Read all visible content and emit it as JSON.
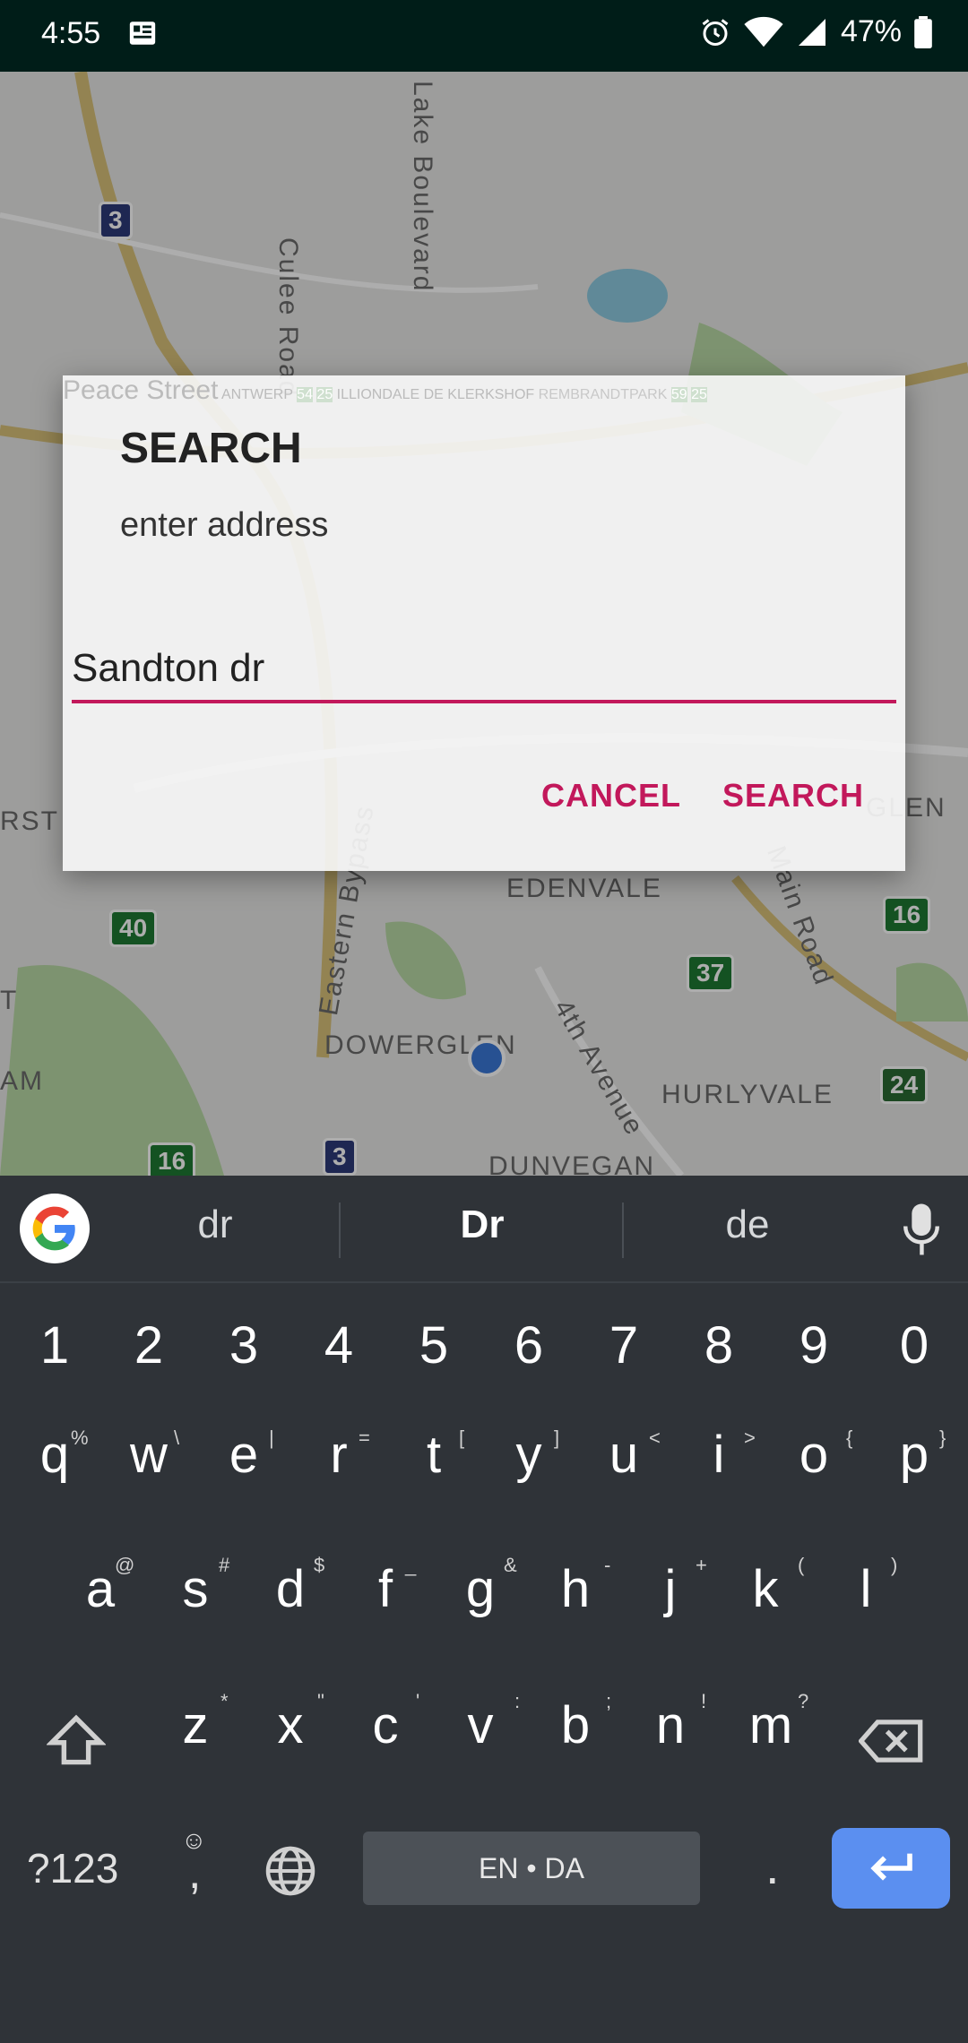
{
  "status_bar": {
    "time": "4:55",
    "battery": "47%"
  },
  "map": {
    "labels": [
      "Culee Road",
      "Lake Boulevard",
      "Peace Street",
      "ANTWERP",
      "ILLIONDALE",
      "DE KLERKSHOF",
      "REMBRANDTPARK",
      "EDENVALE",
      "Main Road",
      "Eastern Bypass",
      "DOWERGLEN",
      "4th Avenue",
      "HURLYVALE",
      "DUNVEGAN",
      "RST",
      "AM",
      "T",
      "GLEN"
    ],
    "route_shields": [
      "3",
      "54",
      "25",
      "59",
      "25",
      "40",
      "37",
      "16",
      "24",
      "16",
      "3"
    ]
  },
  "dialog": {
    "title": "SEARCH",
    "message": "enter address",
    "input_value": "Sandton dr",
    "cancel_label": "CANCEL",
    "search_label": "SEARCH"
  },
  "keyboard": {
    "suggestions": [
      "dr",
      "Dr",
      "de"
    ],
    "number_row": [
      "1",
      "2",
      "3",
      "4",
      "5",
      "6",
      "7",
      "8",
      "9",
      "0"
    ],
    "row1": [
      {
        "key": "q",
        "hint": "%"
      },
      {
        "key": "w",
        "hint": "\\"
      },
      {
        "key": "e",
        "hint": "|"
      },
      {
        "key": "r",
        "hint": "="
      },
      {
        "key": "t",
        "hint": "["
      },
      {
        "key": "y",
        "hint": "]"
      },
      {
        "key": "u",
        "hint": "<"
      },
      {
        "key": "i",
        "hint": ">"
      },
      {
        "key": "o",
        "hint": "{"
      },
      {
        "key": "p",
        "hint": "}"
      }
    ],
    "row2": [
      {
        "key": "a",
        "hint": "@"
      },
      {
        "key": "s",
        "hint": "#"
      },
      {
        "key": "d",
        "hint": "$"
      },
      {
        "key": "f",
        "hint": "_"
      },
      {
        "key": "g",
        "hint": "&"
      },
      {
        "key": "h",
        "hint": "-"
      },
      {
        "key": "j",
        "hint": "+"
      },
      {
        "key": "k",
        "hint": "("
      },
      {
        "key": "l",
        "hint": ")"
      }
    ],
    "row3": [
      {
        "key": "z",
        "hint": "*"
      },
      {
        "key": "x",
        "hint": "\""
      },
      {
        "key": "c",
        "hint": "'"
      },
      {
        "key": "v",
        "hint": ":"
      },
      {
        "key": "b",
        "hint": ";"
      },
      {
        "key": "n",
        "hint": "!"
      },
      {
        "key": "m",
        "hint": "?"
      }
    ],
    "symbols_label": "?123",
    "comma_label": ",",
    "space_label": "EN • DA",
    "period_label": "."
  },
  "colors": {
    "accent": "#c2185b",
    "enter_key": "#5b8ff0",
    "status_bar": "#001d18",
    "keyboard_bg": "#2f3338"
  }
}
